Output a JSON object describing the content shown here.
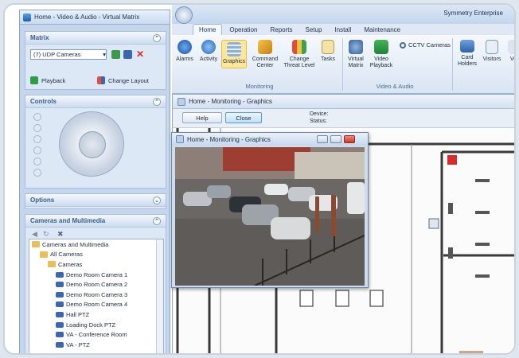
{
  "left_window": {
    "title": "Home - Video & Audio - Virtual Matrix",
    "matrix": {
      "header": "Matrix",
      "selected_source": "(7) UDP Cameras",
      "playback": "Playback",
      "change_layout": "Change Layout"
    },
    "controls": {
      "header": "Controls"
    },
    "options": {
      "header": "Options"
    },
    "cameras": {
      "header": "Cameras and Multimedia",
      "tree": [
        {
          "label": "Cameras and Multimedia",
          "level": 0,
          "type": "root"
        },
        {
          "label": "All Cameras",
          "level": 1,
          "type": "folder"
        },
        {
          "label": "Cameras",
          "level": 2,
          "type": "folder"
        },
        {
          "label": "Demo Room Camera 1",
          "level": 3,
          "type": "camera"
        },
        {
          "label": "Demo Room Camera 2",
          "level": 3,
          "type": "camera"
        },
        {
          "label": "Demo Room Camera 3",
          "level": 3,
          "type": "camera"
        },
        {
          "label": "Demo Room Camera 4",
          "level": 3,
          "type": "camera"
        },
        {
          "label": "Hall PTZ",
          "level": 3,
          "type": "camera"
        },
        {
          "label": "Loading Dock PTZ",
          "level": 3,
          "type": "camera"
        },
        {
          "label": "VA - Conference Room",
          "level": 3,
          "type": "camera"
        },
        {
          "label": "VA - PTZ",
          "level": 3,
          "type": "camera"
        }
      ]
    }
  },
  "main_window": {
    "title": "Symmetry Enterprise",
    "tabs": [
      "Home",
      "Operation",
      "Reports",
      "Setup",
      "Install",
      "Maintenance"
    ],
    "ribbon": {
      "monitoring": {
        "label": "Monitoring",
        "buttons": [
          {
            "label": "Alarms"
          },
          {
            "label": "Activity"
          },
          {
            "label": "Graphics"
          },
          {
            "label": "Command Center"
          },
          {
            "label": "Change Threat Level"
          },
          {
            "label": "Tasks"
          }
        ]
      },
      "video_audio": {
        "label": "Video & Audio",
        "buttons": [
          {
            "label": "Virtual Matrix"
          },
          {
            "label": "Video Playback"
          },
          {
            "label": "CCTV Cameras"
          }
        ]
      },
      "other": {
        "buttons": [
          {
            "label": "Card Holders"
          },
          {
            "label": "Visitors"
          },
          {
            "label": "Ve"
          }
        ]
      }
    },
    "graphics_window": {
      "title": "Home - Monitoring - Graphics",
      "help": "Help",
      "close": "Close",
      "device_label": "Device:",
      "status_label": "Status:"
    },
    "video_popup": {
      "title": "Home - Monitoring - Graphics"
    }
  },
  "colors": {
    "accent": "#3c5d8a",
    "selected_ribbon": "#fde79a",
    "alarm_red": "#d92b2b"
  }
}
